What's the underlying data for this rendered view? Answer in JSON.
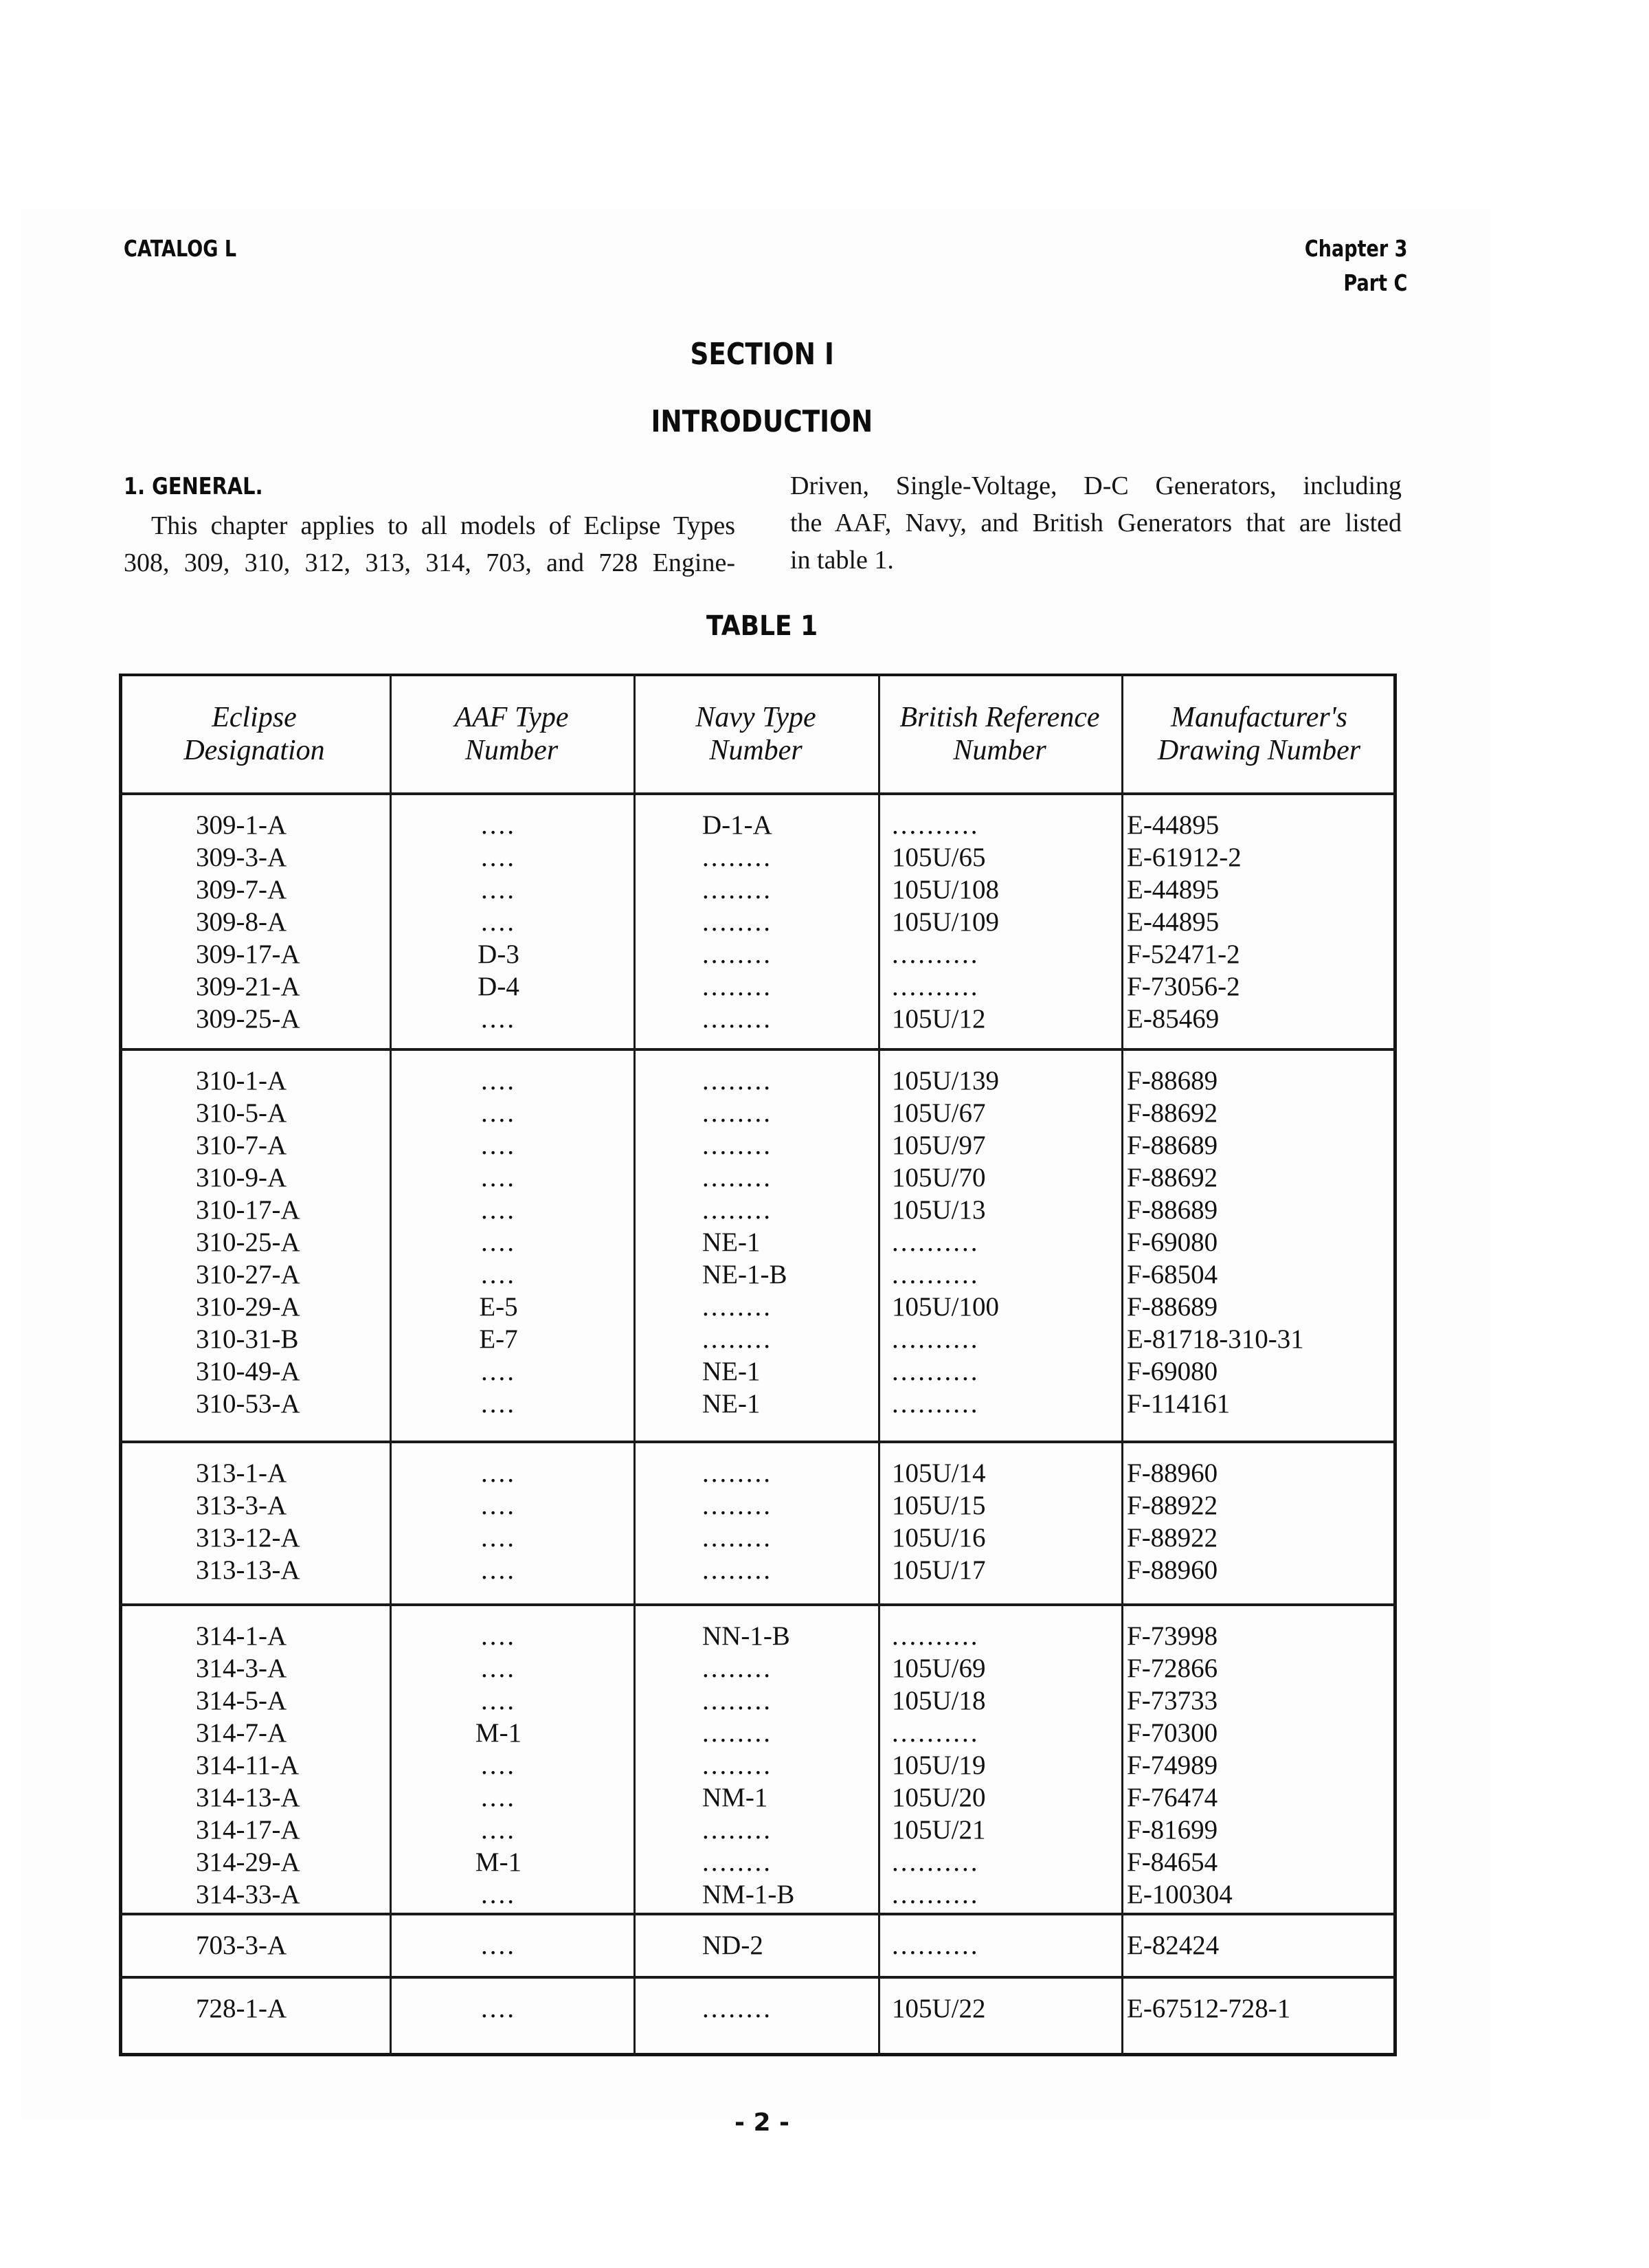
{
  "header": {
    "left": "CATALOG L",
    "right_line1": "Chapter 3",
    "right_line2": "Part C"
  },
  "section_title": "SECTION I",
  "section_subtitle": "INTRODUCTION",
  "general": {
    "heading": "1. GENERAL.",
    "left_lines": [
      "This chapter applies to all models of Eclipse Types",
      "308, 309, 310, 312, 313, 314, 703, and 728 Engine-"
    ],
    "right_lines": [
      "Driven, Single-Voltage, D-C Generators, including",
      "the AAF, Navy, and British Generators that are listed",
      "in table 1."
    ]
  },
  "table": {
    "title": "TABLE 1",
    "columns": [
      {
        "line1": "Eclipse",
        "line2": "Designation"
      },
      {
        "line1": "AAF Type",
        "line2": "Number"
      },
      {
        "line1": "Navy Type",
        "line2": "Number"
      },
      {
        "line1": "British Reference",
        "line2": "Number"
      },
      {
        "line1": "Manufacturer's",
        "line2": "Drawing Number"
      }
    ],
    "groups": [
      [
        [
          "309-1-A",
          "....",
          "D-1-A",
          "..........",
          "E-44895"
        ],
        [
          "309-3-A",
          "....",
          "........",
          "105U/65",
          "E-61912-2"
        ],
        [
          "309-7-A",
          "....",
          "........",
          "105U/108",
          "E-44895"
        ],
        [
          "309-8-A",
          "....",
          "........",
          "105U/109",
          "E-44895"
        ],
        [
          "309-17-A",
          "D-3",
          "........",
          "..........",
          "F-52471-2"
        ],
        [
          "309-21-A",
          "D-4",
          "........",
          "..........",
          "F-73056-2"
        ],
        [
          "309-25-A",
          "....",
          "........",
          "105U/12",
          "E-85469"
        ]
      ],
      [
        [
          "310-1-A",
          "....",
          "........",
          "105U/139",
          "F-88689"
        ],
        [
          "310-5-A",
          "....",
          "........",
          "105U/67",
          "F-88692"
        ],
        [
          "310-7-A",
          "....",
          "........",
          "105U/97",
          "F-88689"
        ],
        [
          "310-9-A",
          "....",
          "........",
          "105U/70",
          "F-88692"
        ],
        [
          "310-17-A",
          "....",
          "........",
          "105U/13",
          "F-88689"
        ],
        [
          "310-25-A",
          "....",
          "NE-1",
          "..........",
          "F-69080"
        ],
        [
          "310-27-A",
          "....",
          "NE-1-B",
          "..........",
          "F-68504"
        ],
        [
          "310-29-A",
          "E-5",
          "........",
          "105U/100",
          "F-88689"
        ],
        [
          "310-31-B",
          "E-7",
          "........",
          "..........",
          "E-81718-310-31"
        ],
        [
          "310-49-A",
          "....",
          "NE-1",
          "..........",
          "F-69080"
        ],
        [
          "310-53-A",
          "....",
          "NE-1",
          "..........",
          "F-114161"
        ]
      ],
      [
        [
          "313-1-A",
          "....",
          "........",
          "105U/14",
          "F-88960"
        ],
        [
          "313-3-A",
          "....",
          "........",
          "105U/15",
          "F-88922"
        ],
        [
          "313-12-A",
          "....",
          "........",
          "105U/16",
          "F-88922"
        ],
        [
          "313-13-A",
          "....",
          "........",
          "105U/17",
          "F-88960"
        ]
      ],
      [
        [
          "314-1-A",
          "....",
          "NN-1-B",
          "..........",
          "F-73998"
        ],
        [
          "314-3-A",
          "....",
          "........",
          "105U/69",
          "F-72866"
        ],
        [
          "314-5-A",
          "....",
          "........",
          "105U/18",
          "F-73733"
        ],
        [
          "314-7-A",
          "M-1",
          "........",
          "..........",
          "F-70300"
        ],
        [
          "314-11-A",
          "....",
          "........",
          "105U/19",
          "F-74989"
        ],
        [
          "314-13-A",
          "....",
          "NM-1",
          "105U/20",
          "F-76474"
        ],
        [
          "314-17-A",
          "....",
          "........",
          "105U/21",
          "F-81699"
        ],
        [
          "314-29-A",
          "M-1",
          "........",
          "..........",
          "F-84654"
        ],
        [
          "314-33-A",
          "....",
          "NM-1-B",
          "..........",
          "E-100304"
        ]
      ],
      [
        [
          "703-3-A",
          "....",
          "ND-2",
          "..........",
          "E-82424"
        ]
      ],
      [
        [
          "728-1-A",
          "....",
          "........",
          "105U/22",
          "E-67512-728-1"
        ]
      ]
    ]
  },
  "page_number": "- 2 -"
}
